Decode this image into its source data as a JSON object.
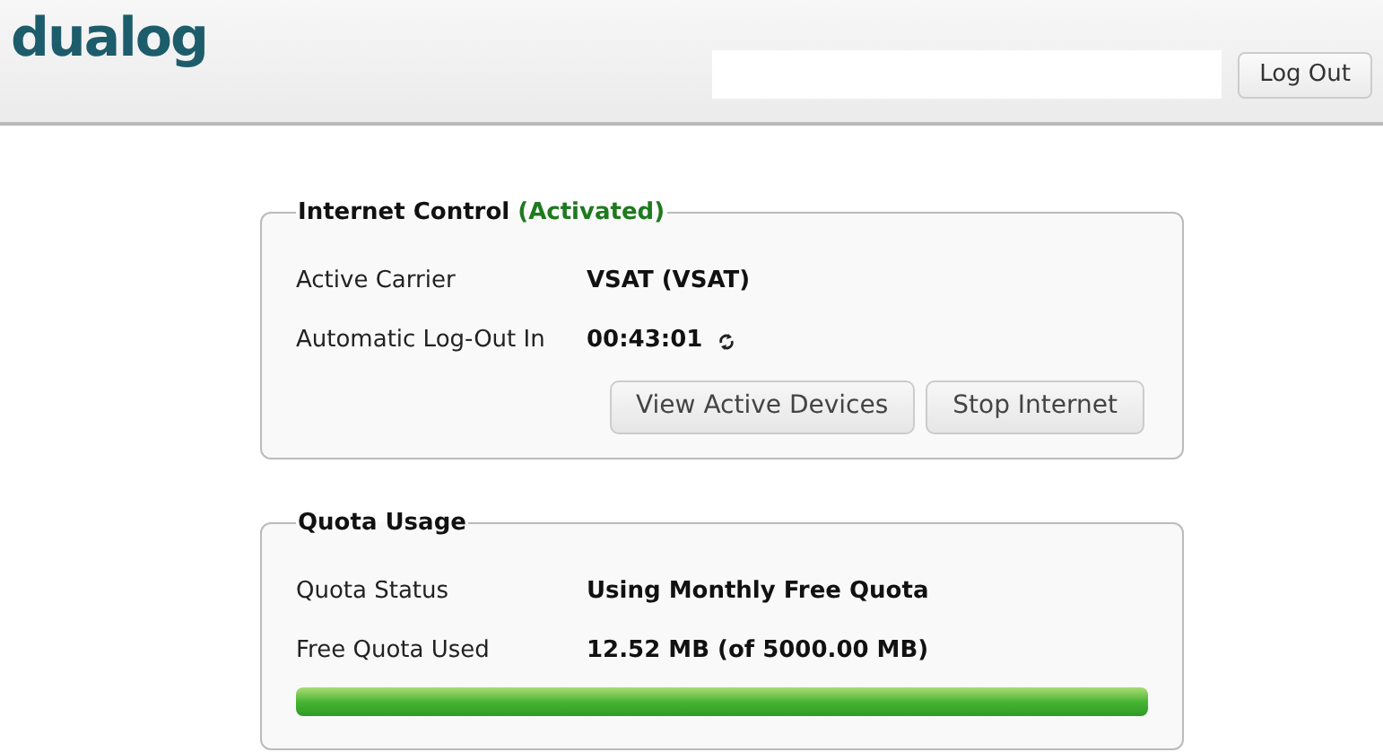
{
  "header": {
    "logo": "dualog",
    "logout_button": "Log Out"
  },
  "internet_control": {
    "title": "Internet Control",
    "status": "(Activated)",
    "rows": [
      {
        "label": "Active Carrier",
        "value": "VSAT (VSAT)",
        "kind": "text"
      },
      {
        "label": "Automatic Log-Out In",
        "value": "00:43:01",
        "kind": "timer"
      }
    ],
    "buttons": [
      "View Active Devices",
      "Stop Internet"
    ]
  },
  "quota_usage": {
    "title": "Quota Usage",
    "rows": [
      {
        "label": "Quota Status",
        "value": "Using Monthly Free Quota"
      },
      {
        "label": "Free Quota Used",
        "value": "12.52 MB (of 5000.00 MB)"
      }
    ]
  }
}
